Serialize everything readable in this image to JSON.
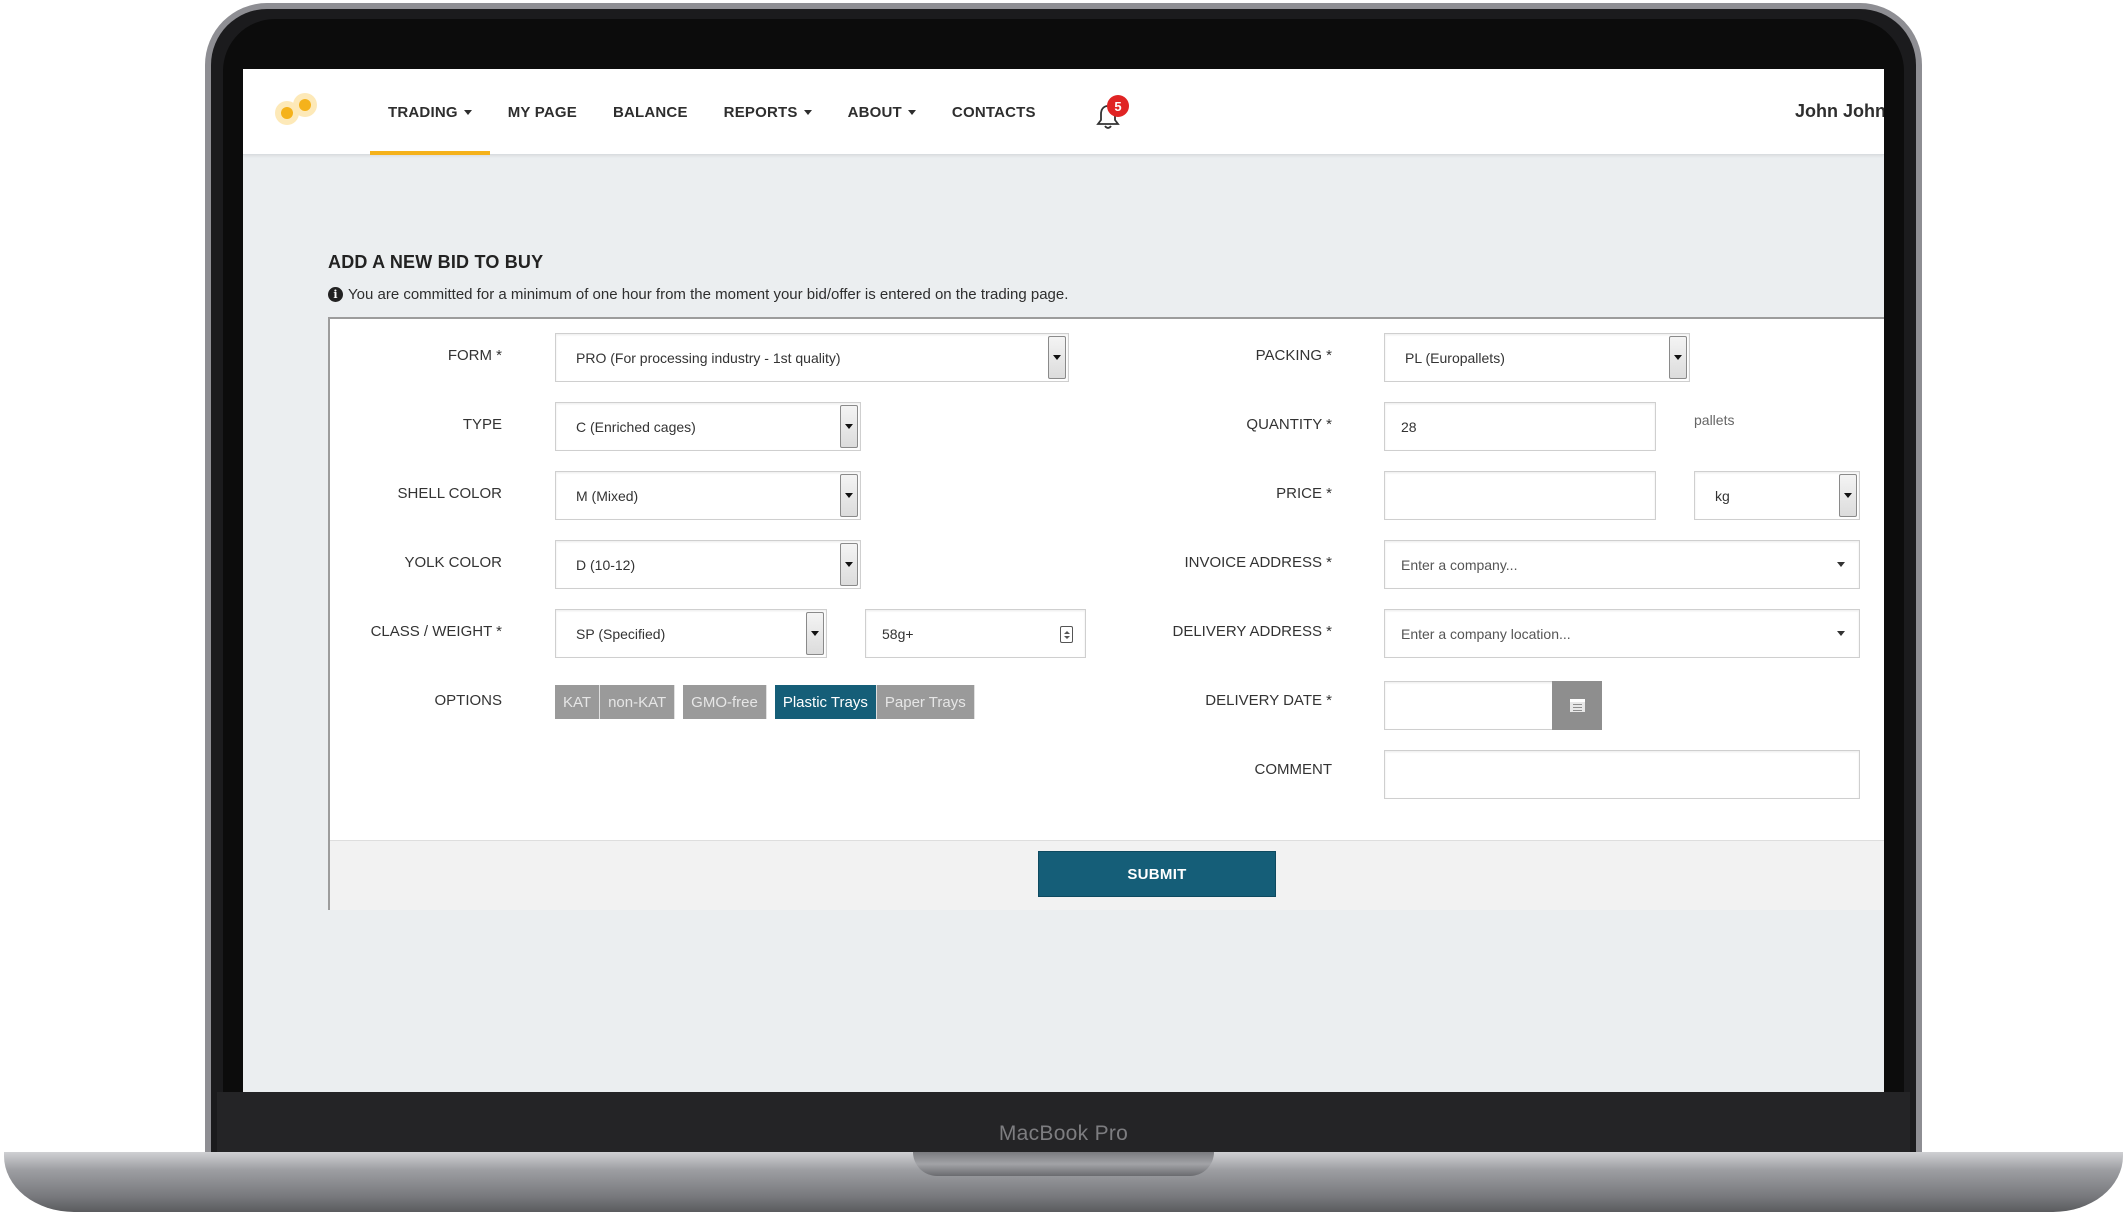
{
  "device": {
    "brand": "MacBook Pro"
  },
  "nav": {
    "items": [
      {
        "label": "TRADING",
        "dropdown": true,
        "active": true
      },
      {
        "label": "MY PAGE",
        "dropdown": false
      },
      {
        "label": "BALANCE",
        "dropdown": false
      },
      {
        "label": "REPORTS",
        "dropdown": true
      },
      {
        "label": "ABOUT",
        "dropdown": true
      },
      {
        "label": "CONTACTS",
        "dropdown": false
      }
    ],
    "notifications_count": "5",
    "user_name": "John John",
    "accent_color": "#f5b21b"
  },
  "page": {
    "title": "ADD A NEW BID TO BUY",
    "notice": "You are committed for a minimum of one hour from the moment your bid/offer is entered on the trading page."
  },
  "form": {
    "form": {
      "label": "FORM *",
      "value": "PRO (For processing industry - 1st quality)"
    },
    "type": {
      "label": "TYPE",
      "value": "C (Enriched cages)"
    },
    "shell_color": {
      "label": "SHELL COLOR",
      "value": "M (Mixed)"
    },
    "yolk_color": {
      "label": "YOLK COLOR",
      "value": "D (10-12)"
    },
    "class_weight": {
      "label": "CLASS / WEIGHT *",
      "value": "SP (Specified)",
      "weight": "58g+"
    },
    "options": {
      "label": "OPTIONS",
      "items": [
        {
          "label": "KAT",
          "selected": false
        },
        {
          "label": "non-KAT",
          "selected": false
        },
        {
          "label": "GMO-free",
          "selected": false
        },
        {
          "label": "Plastic Trays",
          "selected": true
        },
        {
          "label": "Paper Trays",
          "selected": false
        }
      ]
    },
    "packing": {
      "label": "PACKING *",
      "value": "PL (Europallets)"
    },
    "quantity": {
      "label": "QUANTITY *",
      "value": "28",
      "unit": "pallets"
    },
    "price": {
      "label": "PRICE *",
      "value": "",
      "unit": "kg"
    },
    "invoice_address": {
      "label": "INVOICE ADDRESS *",
      "placeholder": "Enter a company..."
    },
    "delivery_address": {
      "label": "DELIVERY ADDRESS *",
      "placeholder": "Enter a company location..."
    },
    "delivery_date": {
      "label": "DELIVERY DATE *",
      "value": ""
    },
    "comment": {
      "label": "COMMENT",
      "value": ""
    },
    "submit_label": "SUBMIT",
    "primary_color": "#155e78"
  }
}
